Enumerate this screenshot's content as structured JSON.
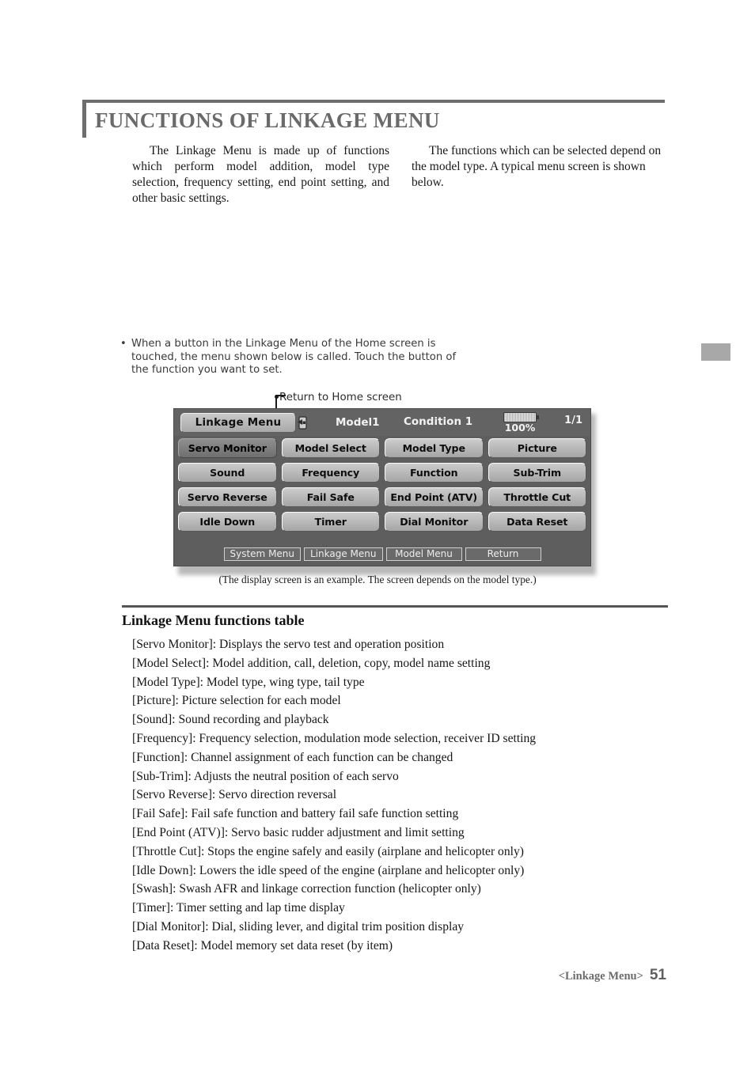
{
  "page": {
    "heading": "FUNCTIONS OF LINKAGE MENU",
    "intro_left": "The Linkage Menu is made up of functions which perform model addition, model type selection, frequency setting, end point setting, and other basic settings.",
    "intro_right": "The functions which can be selected depend on the model type. A typical menu screen is shown below.",
    "bullet": "•",
    "note": "When a button in the Linkage Menu of the Home screen is touched, the menu shown below is called. Touch the button of the function you want to set.",
    "callout": "Return to Home screen",
    "caption": "(The display screen is an example. The screen depends on the model type.)",
    "section_title": "Linkage Menu functions table",
    "footer_label": "<Linkage Menu>",
    "footer_page": "51",
    "accent_gray": "#6e6e6e",
    "margin_tab_color": "#a8a8a8"
  },
  "lcd": {
    "menu_tab_label": "Linkage Menu",
    "home_icon": "home-return-icon",
    "model_name": "Model1",
    "condition": "Condition 1",
    "battery_icon": "battery-icon",
    "battery_percent": "100%",
    "page_count": "1/1",
    "buttons": [
      {
        "label": "Servo Monitor",
        "selected": true
      },
      {
        "label": "Model Select",
        "selected": false
      },
      {
        "label": "Model Type",
        "selected": false
      },
      {
        "label": "Picture",
        "selected": false
      },
      {
        "label": "Sound",
        "selected": false
      },
      {
        "label": "Frequency",
        "selected": false
      },
      {
        "label": "Function",
        "selected": false
      },
      {
        "label": "Sub-Trim",
        "selected": false
      },
      {
        "label": "Servo Reverse",
        "selected": false
      },
      {
        "label": "Fail Safe",
        "selected": false
      },
      {
        "label": "End Point (ATV)",
        "selected": false
      },
      {
        "label": "Throttle Cut",
        "selected": false
      },
      {
        "label": "Idle Down",
        "selected": false
      },
      {
        "label": "Timer",
        "selected": false
      },
      {
        "label": "Dial Monitor",
        "selected": false
      },
      {
        "label": "Data Reset",
        "selected": false
      }
    ],
    "nav": [
      {
        "label": "System Menu"
      },
      {
        "label": "Linkage Menu"
      },
      {
        "label": "Model Menu"
      },
      {
        "label": "Return"
      }
    ]
  },
  "functions_table": [
    "[Servo Monitor]: Displays the servo test and operation position",
    "[Model Select]: Model addition, call, deletion, copy, model name setting",
    "[Model Type]: Model type, wing type, tail type",
    "[Picture]: Picture selection for each model",
    "[Sound]: Sound recording and playback",
    "[Frequency]: Frequency selection, modulation mode selection, receiver ID setting",
    "[Function]: Channel assignment of each function can be changed",
    "[Sub-Trim]: Adjusts the neutral position of each servo",
    "[Servo Reverse]: Servo direction reversal",
    "[Fail Safe]: Fail safe function and battery fail safe function setting",
    "[End Point (ATV)]: Servo basic rudder adjustment and limit setting",
    "[Throttle Cut]: Stops the engine safely and easily (airplane and helicopter only)",
    "[Idle Down]: Lowers the idle speed of the engine (airplane and helicopter only)",
    "[Swash]: Swash AFR and linkage correction function (helicopter only)",
    "[Timer]: Timer setting and lap time display",
    "[Dial Monitor]: Dial, sliding lever, and digital trim position display",
    "[Data Reset]: Model memory set data reset (by item)"
  ]
}
